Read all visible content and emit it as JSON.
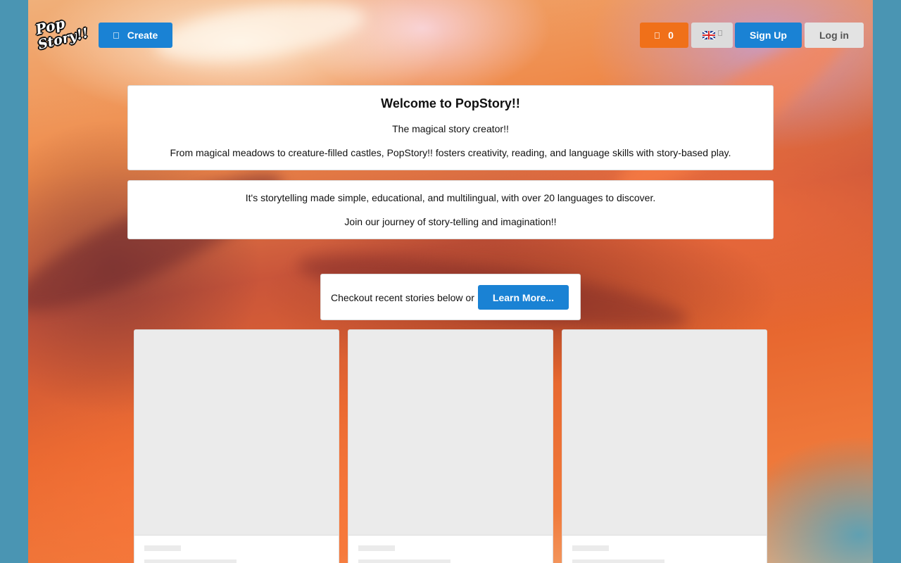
{
  "header": {
    "logo_line1": "Pop",
    "logo_line2": "Story!!",
    "create_label": "Create",
    "coins_count": "0",
    "language_flag": "uk-flag-icon",
    "signup_label": "Sign Up",
    "login_label": "Log in"
  },
  "welcome": {
    "title": "Welcome to PopStory!!",
    "subtitle": "The magical story creator!!",
    "description": "From magical meadows to creature-filled castles, PopStory!! fosters creativity, reading, and language skills with story-based play."
  },
  "about": {
    "line1": "It's storytelling made simple, educational, and multilingual, with over 20 languages to discover.",
    "line2": "Join our journey of story-telling and imagination!!"
  },
  "cta": {
    "text": "Checkout recent stories below or",
    "learn_more_label": "Learn More..."
  },
  "colors": {
    "primary": "#1a82d4",
    "coins": "#f07019",
    "page_background": "#4a95b3"
  }
}
